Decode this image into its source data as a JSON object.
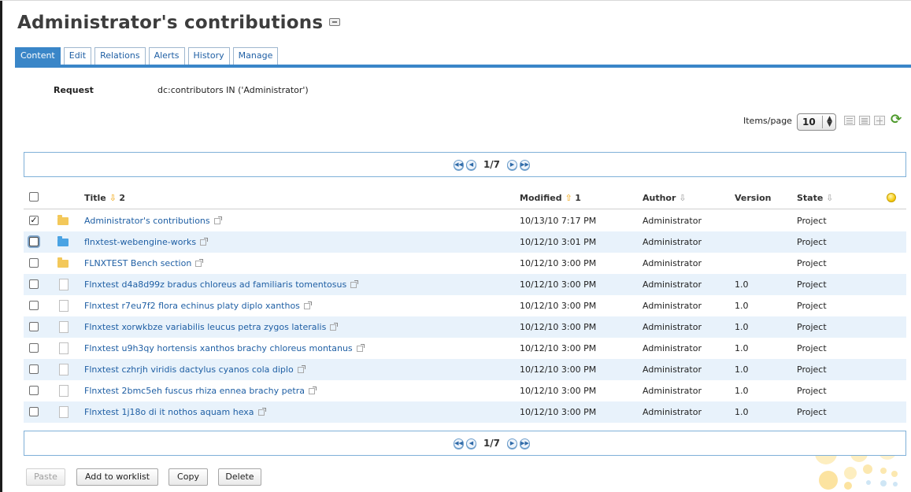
{
  "page": {
    "title": "Administrator's contributions"
  },
  "tabs": [
    {
      "label": "Content",
      "active": true
    },
    {
      "label": "Edit"
    },
    {
      "label": "Relations"
    },
    {
      "label": "Alerts"
    },
    {
      "label": "History"
    },
    {
      "label": "Manage"
    }
  ],
  "request": {
    "label": "Request",
    "value": "dc:contributors IN ('Administrator')"
  },
  "items_per_page": {
    "label": "Items/page",
    "value": "10"
  },
  "view_icons": [
    "list-view-icon",
    "compact-list-view-icon",
    "thumbnail-view-icon",
    "refresh-icon"
  ],
  "pager": {
    "text": "1/7"
  },
  "table": {
    "columns": {
      "title": "Title",
      "title_sort": "2",
      "modified": "Modified",
      "modified_sort": "1",
      "author": "Author",
      "version": "Version",
      "state": "State"
    },
    "rows": [
      {
        "icon": "folder-icon",
        "title": "Administrator's contributions",
        "modified": "10/13/10 7:17 PM",
        "author": "Administrator",
        "version": "",
        "state": "Project",
        "checked": true
      },
      {
        "icon": "workspace-icon",
        "title": "flnxtest-webengine-works",
        "modified": "10/12/10 3:01 PM",
        "author": "Administrator",
        "version": "",
        "state": "Project"
      },
      {
        "icon": "folder-icon",
        "title": "FLNXTEST Bench section",
        "modified": "10/12/10 3:00 PM",
        "author": "Administrator",
        "version": "",
        "state": "Project"
      },
      {
        "icon": "document-icon",
        "title": "Flnxtest d4a8d99z bradus chloreus ad familiaris tomentosus",
        "modified": "10/12/10 3:00 PM",
        "author": "Administrator",
        "version": "1.0",
        "state": "Project"
      },
      {
        "icon": "document-icon",
        "title": "Flnxtest r7eu7f2 flora echinus platy diplo xanthos",
        "modified": "10/12/10 3:00 PM",
        "author": "Administrator",
        "version": "1.0",
        "state": "Project"
      },
      {
        "icon": "document-icon",
        "title": "Flnxtest xorwkbze variabilis leucus petra zygos lateralis",
        "modified": "10/12/10 3:00 PM",
        "author": "Administrator",
        "version": "1.0",
        "state": "Project"
      },
      {
        "icon": "document-icon",
        "title": "Flnxtest u9h3qy hortensis xanthos brachy chloreus montanus",
        "modified": "10/12/10 3:00 PM",
        "author": "Administrator",
        "version": "1.0",
        "state": "Project"
      },
      {
        "icon": "document-icon",
        "title": "Flnxtest czhrjh viridis dactylus cyanos cola diplo",
        "modified": "10/12/10 3:00 PM",
        "author": "Administrator",
        "version": "1.0",
        "state": "Project"
      },
      {
        "icon": "document-icon",
        "title": "Flnxtest 2bmc5eh fuscus rhiza ennea brachy petra",
        "modified": "10/12/10 3:00 PM",
        "author": "Administrator",
        "version": "1.0",
        "state": "Project"
      },
      {
        "icon": "document-icon",
        "title": "Flnxtest 1j18o di it nothos aquam hexa",
        "modified": "10/12/10 3:00 PM",
        "author": "Administrator",
        "version": "1.0",
        "state": "Project"
      }
    ]
  },
  "actions": {
    "paste": "Paste",
    "add_to_worklist": "Add to worklist",
    "copy": "Copy",
    "delete": "Delete"
  },
  "colors": {
    "accent": "#3a86c8",
    "link": "#1f5fa4",
    "row_alt": "#e8f2fb",
    "sort_arrow": "#f0a000"
  }
}
